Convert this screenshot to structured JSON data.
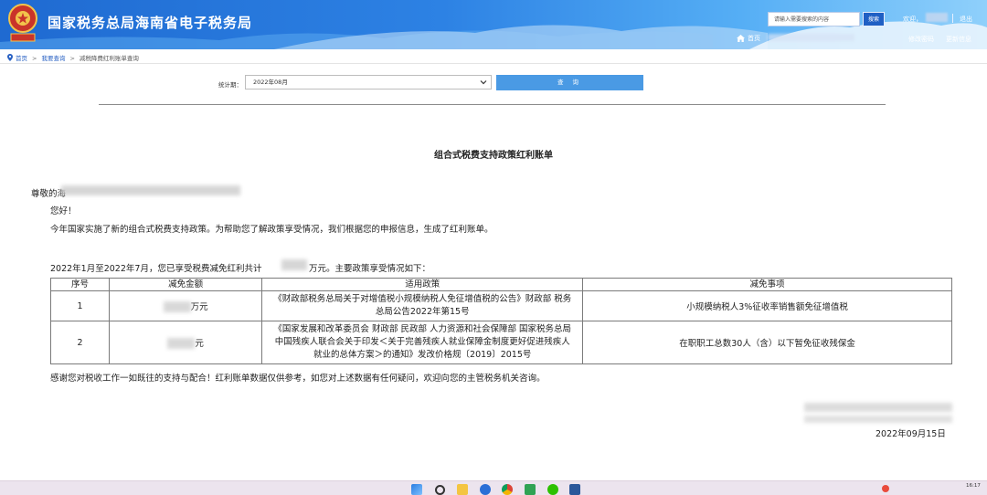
{
  "header": {
    "site_title": "国家税务总局海南省电子税务局",
    "search_placeholder": "请输入需要搜索的内容",
    "search_button": "搜索",
    "welcome": "欢迎，",
    "logout": "退出",
    "home": "首页",
    "change_password": "修改密码",
    "update_info": "更新信息"
  },
  "breadcrumb": {
    "items": [
      "首页",
      "我要查询",
      "减税降费红利账单查询"
    ]
  },
  "query": {
    "period_label": "统计期：",
    "period_value": "2022年08月",
    "query_button": "查 询"
  },
  "document": {
    "title": "组合式税费支持政策红利账单",
    "greeting_prefix": "尊敬的海",
    "hello": "您好！",
    "intro": "今年国家实施了新的组合式税费支持政策。为帮助您了解政策享受情况，我们根据您的申报信息，生成了红利账单。",
    "summary_prefix": "2022年1月至2022年7月，您已享受税费减免红利共计",
    "summary_suffix": "万元。主要政策享受情况如下：",
    "table": {
      "headers": [
        "序号",
        "减免金额",
        "适用政策",
        "减免事项"
      ],
      "rows": [
        {
          "no": "1",
          "amount_suffix": "万元",
          "policy_lines": [
            "《财政部税务总局关于对增值税小规模纳税人免征增值税的公告》财政部 税务",
            "总局公告2022年第15号"
          ],
          "item": "小规模纳税人3%征收率销售额免征增值税"
        },
        {
          "no": "2",
          "amount_suffix": "元",
          "policy_lines": [
            "《国家发展和改革委员会 财政部 民政部 人力资源和社会保障部 国家税务总局",
            "中国残疾人联合会关于印发＜关于完善残疾人就业保障金制度更好促进残疾人",
            "就业的总体方案＞的通知》发改价格规〔2019〕2015号"
          ],
          "item": "在职职工总数30人（含）以下暂免征收残保金"
        }
      ]
    },
    "thanks": "感谢您对税收工作一如既往的支持与配合！红利账单数据仅供参考，如您对上述数据有任何疑问，欢迎向您的主管税务机关咨询。",
    "date": "2022年09月15日"
  },
  "taskbar": {
    "clock": "16:17"
  },
  "colors": {
    "header_blue": "#2d82e4",
    "query_button": "#4a9ae4",
    "link_blue": "#2b63c4"
  }
}
